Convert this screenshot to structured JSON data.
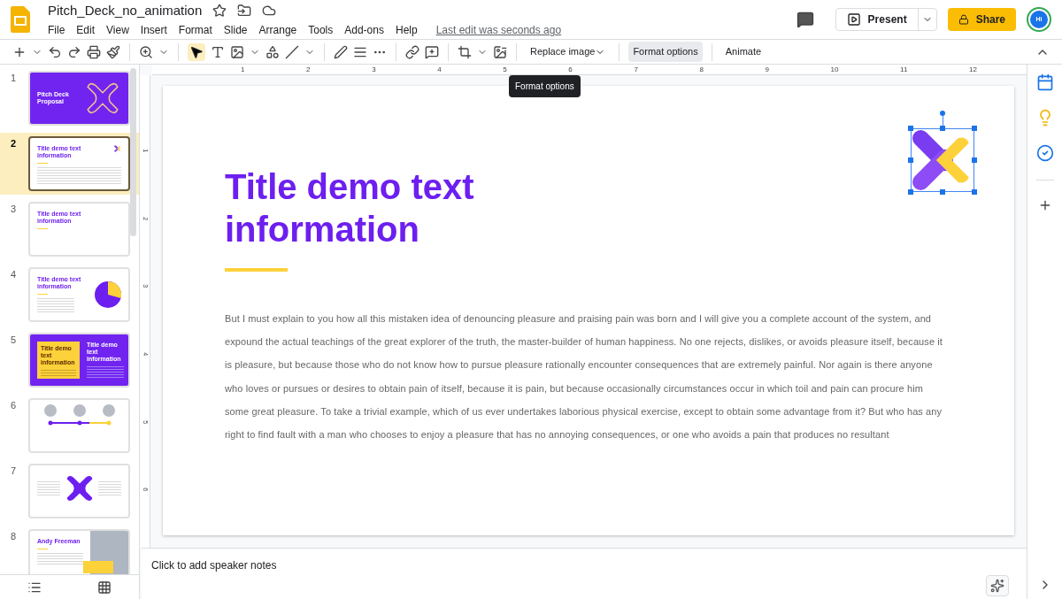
{
  "document": {
    "title": "Pitch_Deck_no_animation",
    "last_edit": "Last edit was seconds ago"
  },
  "menu": [
    "File",
    "Edit",
    "View",
    "Insert",
    "Format",
    "Slide",
    "Arrange",
    "Tools",
    "Add-ons",
    "Help"
  ],
  "header_buttons": {
    "present": "Present",
    "share": "Share",
    "avatar": "Hi"
  },
  "toolbar": {
    "pointer_selected": true,
    "buttons": [
      {
        "label": "Replace image",
        "dropdown": true,
        "hovered": false
      },
      {
        "label": "Format options",
        "dropdown": false,
        "hovered": true
      },
      {
        "label": "Animate",
        "dropdown": false,
        "hovered": false
      }
    ],
    "tooltip": "Format options"
  },
  "ruler": {
    "horizontal": [
      "1",
      "2",
      "3",
      "4",
      "5",
      "6",
      "7",
      "8",
      "9",
      "10",
      "11",
      "12"
    ],
    "vertical": [
      "1",
      "2",
      "3",
      "4",
      "5",
      "6"
    ]
  },
  "slides": [
    {
      "number": "1",
      "selected": false,
      "kind": "cover",
      "title": "Pitch Deck Proposal"
    },
    {
      "number": "2",
      "selected": true,
      "kind": "text",
      "title": "Title demo text information"
    },
    {
      "number": "3",
      "selected": false,
      "kind": "two-column",
      "title": "Title demo text information"
    },
    {
      "number": "4",
      "selected": false,
      "kind": "pie",
      "title": "Title demo text information"
    },
    {
      "number": "5",
      "selected": false,
      "kind": "split",
      "title": "Title demo text information",
      "title_2": "Title demo text information"
    },
    {
      "number": "6",
      "selected": false,
      "kind": "timeline"
    },
    {
      "number": "7",
      "selected": false,
      "kind": "cross"
    },
    {
      "number": "8",
      "selected": false,
      "kind": "profile",
      "title": "Andy Freeman"
    }
  ],
  "slide": {
    "title": "Title demo text information",
    "body": "But I must explain to you how all this mistaken idea of denouncing pleasure and praising pain was born and I will give you a complete account of the system, and expound the actual teachings of the great explorer of the truth, the master-builder of human happiness. No one rejects, dislikes, or avoids pleasure itself, because it is pleasure, but because those who do not know how to pursue pleasure rationally encounter consequences that are extremely painful. Nor again is there anyone who loves or pursues or desires to obtain pain of itself, because it is pain, but because occasionally circumstances occur in which toil and pain can procure him some great pleasure. To take a trivial example, which of us ever undertakes laborious physical exercise, except to obtain some advantage from it? But who has any right to find fault with a man who chooses to enjoy a pleasure that has no annoying consequences, or one who avoids a pain that produces no resultant",
    "logo_selected": true
  },
  "speaker_notes": {
    "placeholder": "Click to add speaker notes"
  }
}
